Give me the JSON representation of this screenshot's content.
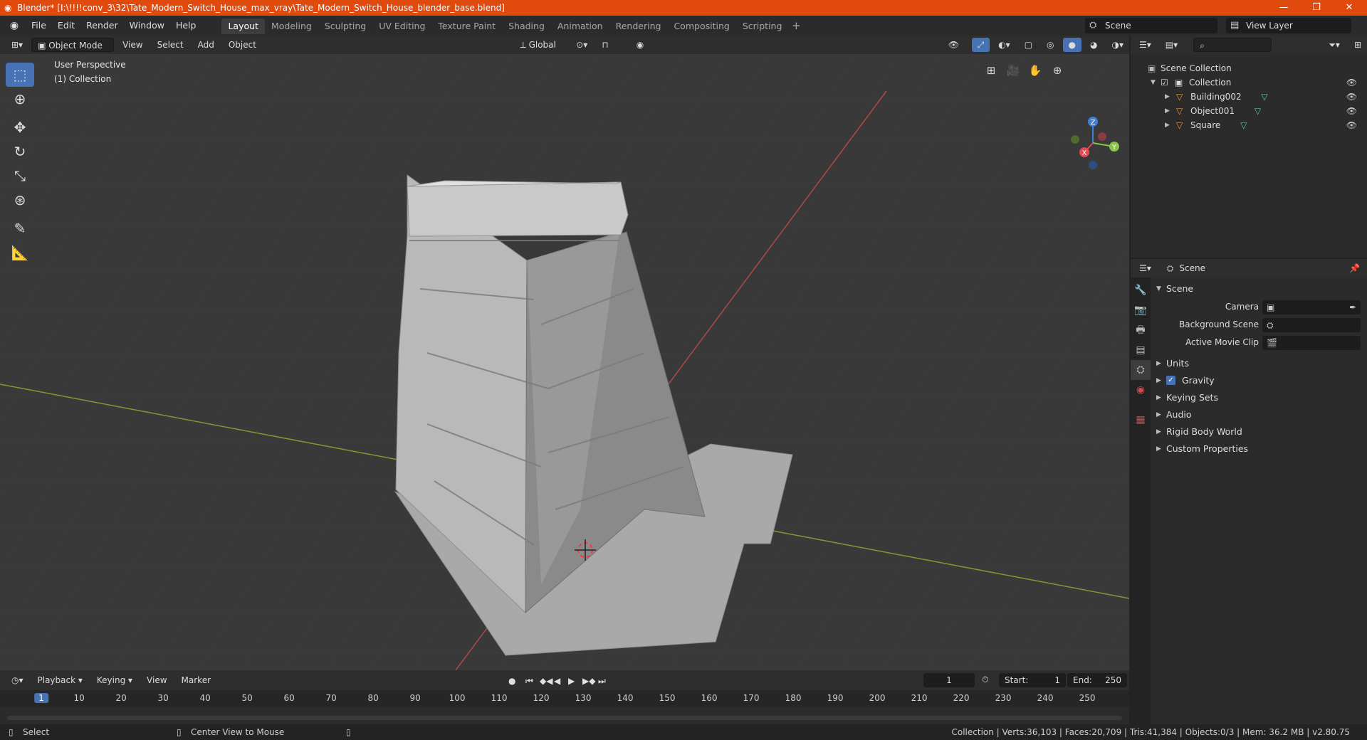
{
  "window": {
    "title": "Blender* [I:\\!!!!conv_3\\32\\Tate_Modern_Switch_House_max_vray\\Tate_Modern_Switch_House_blender_base.blend]",
    "minimize": "—",
    "maximize": "❐",
    "close": "✕"
  },
  "menu": [
    "File",
    "Edit",
    "Render",
    "Window",
    "Help"
  ],
  "workspaces": [
    "Layout",
    "Modeling",
    "Sculpting",
    "UV Editing",
    "Texture Paint",
    "Shading",
    "Animation",
    "Rendering",
    "Compositing",
    "Scripting"
  ],
  "active_workspace": "Layout",
  "scene_selector": "Scene",
  "view_layer_selector": "View Layer",
  "viewport_header": {
    "mode": "Object Mode",
    "menus": [
      "View",
      "Select",
      "Add",
      "Object"
    ],
    "transform_orientation": "Global"
  },
  "viewport": {
    "perspective_label": "User Perspective",
    "collection_label": "(1) Collection",
    "gizmo_axes": {
      "z": "Z",
      "y": "Y",
      "x": "X"
    }
  },
  "outliner": {
    "root": "Scene Collection",
    "collection": "Collection",
    "objects": [
      "Building002",
      "Object001",
      "Square"
    ]
  },
  "properties": {
    "header_title": "Scene",
    "section": "Scene",
    "fields": [
      {
        "label": "Camera",
        "value": ""
      },
      {
        "label": "Background Scene",
        "value": ""
      },
      {
        "label": "Active Movie Clip",
        "value": ""
      }
    ],
    "panels": [
      "Units",
      "Gravity",
      "Keying Sets",
      "Audio",
      "Rigid Body World",
      "Custom Properties"
    ],
    "gravity_checked": true
  },
  "timeline": {
    "menus": [
      "Playback",
      "Keying",
      "View",
      "Marker"
    ],
    "current_frame": "1",
    "start_label": "Start:",
    "start": "1",
    "end_label": "End:",
    "end": "250",
    "ticks": [
      "1",
      "10",
      "20",
      "30",
      "40",
      "50",
      "60",
      "70",
      "80",
      "90",
      "100",
      "110",
      "120",
      "130",
      "140",
      "150",
      "160",
      "170",
      "180",
      "190",
      "200",
      "210",
      "220",
      "230",
      "240",
      "250"
    ]
  },
  "statusbar": {
    "left_action": "Select",
    "middle_action": "Center View to Mouse",
    "stats": "Collection | Verts:36,103 | Faces:20,709 | Tris:41,384 | Objects:0/3 | Mem: 36.2 MB | v2.80.75"
  },
  "colors": {
    "titlebar": "#e04a0c",
    "active_tool": "#4772b3",
    "x_axis": "#e04a55",
    "y_axis": "#8bc34a",
    "z_axis": "#3f7fd8"
  }
}
